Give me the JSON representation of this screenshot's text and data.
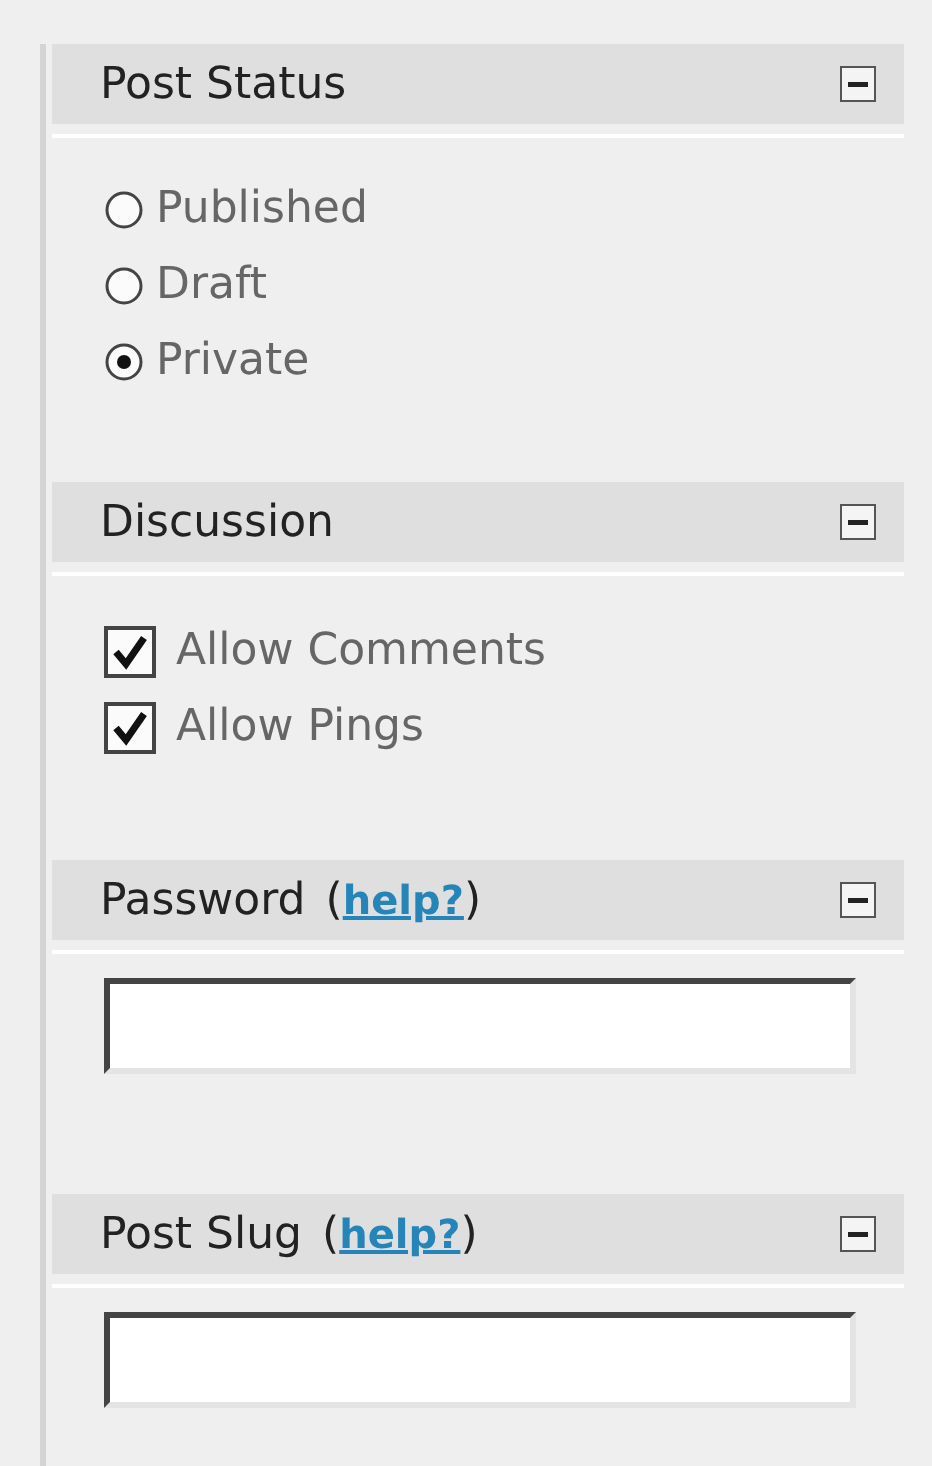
{
  "sections": [
    {
      "kind": "radio",
      "title": "Post Status",
      "options": [
        {
          "label": "Published",
          "selected": false
        },
        {
          "label": "Draft",
          "selected": false
        },
        {
          "label": "Private",
          "selected": true
        }
      ]
    },
    {
      "kind": "checkbox",
      "title": "Discussion",
      "options": [
        {
          "label": "Allow Comments",
          "checked": true
        },
        {
          "label": "Allow Pings",
          "checked": true
        }
      ]
    },
    {
      "kind": "field",
      "title": "Password",
      "help": {
        "before": "(",
        "link": "help?",
        "after": ")"
      }
    },
    {
      "kind": "field",
      "title": "Post Slug",
      "help": {
        "before": "(",
        "link": "help?",
        "after": ")"
      }
    }
  ]
}
